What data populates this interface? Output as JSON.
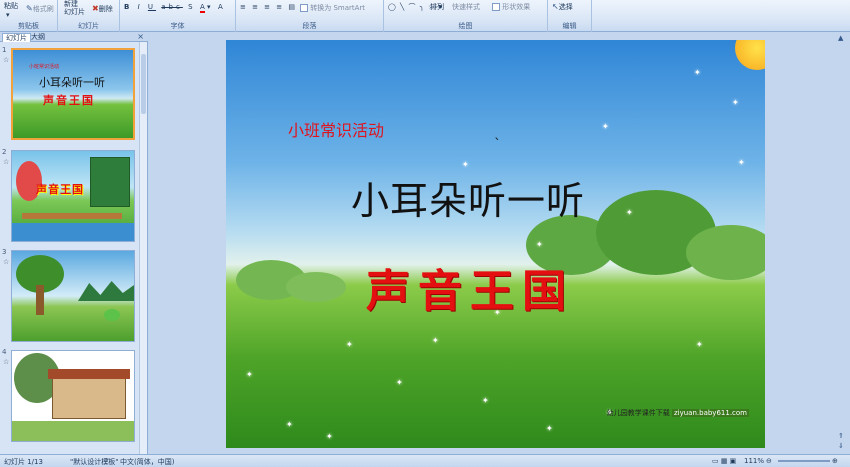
{
  "ribbon": {
    "clipboard": {
      "paste": "粘贴",
      "format_painter": "格式刷",
      "label": "剪贴板"
    },
    "slides": {
      "new_slide": "新建\n幻灯片",
      "delete": "删除",
      "label": "幻灯片"
    },
    "font": {
      "label": "字体",
      "size_hint": "A",
      "grow": "A",
      "shrink": "A",
      "color": "A"
    },
    "paragraph": {
      "smartart": "转换为 SmartArt",
      "label": "段落"
    },
    "drawing": {
      "arrange": "排列",
      "quick_styles": "快速样式",
      "shape_effects": "形状效果",
      "label": "绘图"
    },
    "editing": {
      "select": "选择",
      "label": "编辑"
    }
  },
  "panel": {
    "tab_slides": "幻灯片",
    "tab_outline": "大纲",
    "close": "×",
    "thumbs": [
      {
        "num": "1",
        "anim": "☆"
      },
      {
        "num": "2",
        "anim": "☆"
      },
      {
        "num": "3",
        "anim": "☆"
      },
      {
        "num": "4",
        "anim": "☆"
      }
    ],
    "thumb1": {
      "sub": "小班常识活动",
      "title": "小耳朵听一听",
      "red": "声音王国"
    },
    "thumb2": {
      "red": "声音王国"
    }
  },
  "slide": {
    "subtitle": "小班常识活动",
    "tick": "`",
    "title": "小耳朵听一听",
    "red_title": "声音王国",
    "footer_text": "幼儿园教学课件下载",
    "footer_url": "ziyuan.baby611.com"
  },
  "status": {
    "slide_pos": "幻灯片 1/13",
    "theme": "\"默认设计模板\"",
    "language": "中文(简体，中国)",
    "zoom": "111%"
  }
}
